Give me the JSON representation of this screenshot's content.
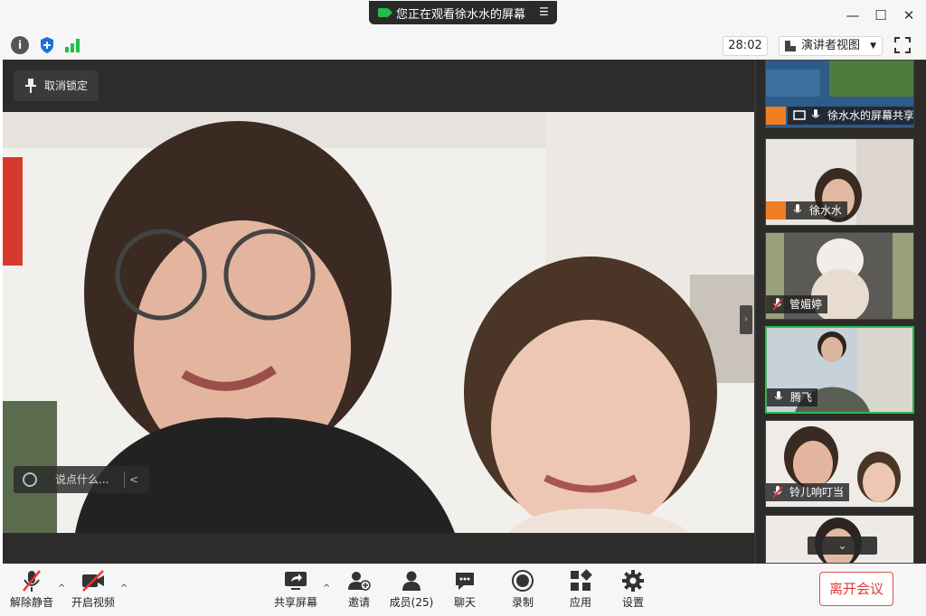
{
  "titlebar": {
    "share_text": "您正在观看徐水水的屏幕",
    "minimize": "—",
    "maximize": "☐",
    "close": "✕"
  },
  "topbar": {
    "info_icon": "i",
    "timer": "28:02",
    "view_mode": "演讲者视图"
  },
  "stage": {
    "unpin_label": "取消锁定",
    "chat_placeholder": "说点什么...",
    "chat_collapse": "<"
  },
  "participants": [
    {
      "name": "徐水水的屏幕共享",
      "host": true,
      "muted": false,
      "kind": "screen"
    },
    {
      "name": "徐水水",
      "host": true,
      "muted": false,
      "kind": "video"
    },
    {
      "name": "管媚婷",
      "host": false,
      "muted": true,
      "kind": "video"
    },
    {
      "name": "腾飞",
      "host": false,
      "muted": false,
      "kind": "video",
      "active": true
    },
    {
      "name": "铃儿响叮当",
      "host": false,
      "muted": true,
      "kind": "video"
    }
  ],
  "sidebar": {
    "scroll_down": "⌄",
    "collapse": "›"
  },
  "toolbar": {
    "unmute": "解除静音",
    "start_video": "开启视频",
    "share_screen": "共享屏幕",
    "invite": "邀请",
    "members": "成员(25)",
    "chat": "聊天",
    "record": "录制",
    "apps": "应用",
    "settings": "设置",
    "leave": "离开会议",
    "caret": "^"
  },
  "colors": {
    "accent_green": "#2dba4e",
    "leave_red": "#e03a3a",
    "host_orange": "#f07e23",
    "stage_dark": "#2e2c2b"
  }
}
